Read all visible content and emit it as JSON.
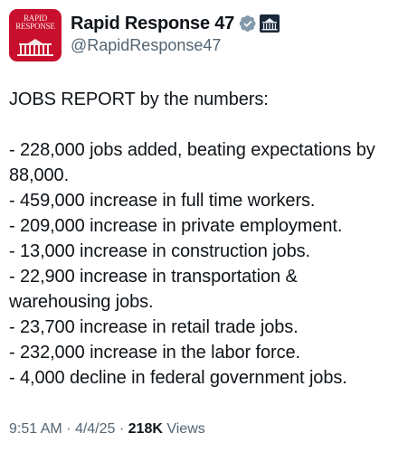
{
  "author": {
    "display_name": "Rapid Response 47",
    "handle": "@RapidResponse47",
    "avatar_text": [
      "RAPID",
      "RESPONSE"
    ],
    "verified_color": "#829aab",
    "avatar_color": "#c8102e"
  },
  "post": {
    "heading": "JOBS REPORT by the numbers:",
    "items": [
      "- 228,000 jobs added, beating expectations by 88,000.",
      "- 459,000 increase in full time workers.",
      "- 209,000 increase in private employment.",
      "- 13,000 increase in construction jobs.",
      "- 22,900 increase in transportation & warehousing jobs.",
      "- 23,700 increase in retail trade jobs.",
      "- 232,000 increase in the labor force.",
      "- 4,000 decline in federal government jobs."
    ]
  },
  "meta": {
    "time": "9:51 AM",
    "separator": "·",
    "date": "4/4/25",
    "views_count": "218K",
    "views_label": "Views"
  },
  "icons": {
    "verified": "verified-badge-icon",
    "affiliate": "white-house-affiliate-icon"
  }
}
